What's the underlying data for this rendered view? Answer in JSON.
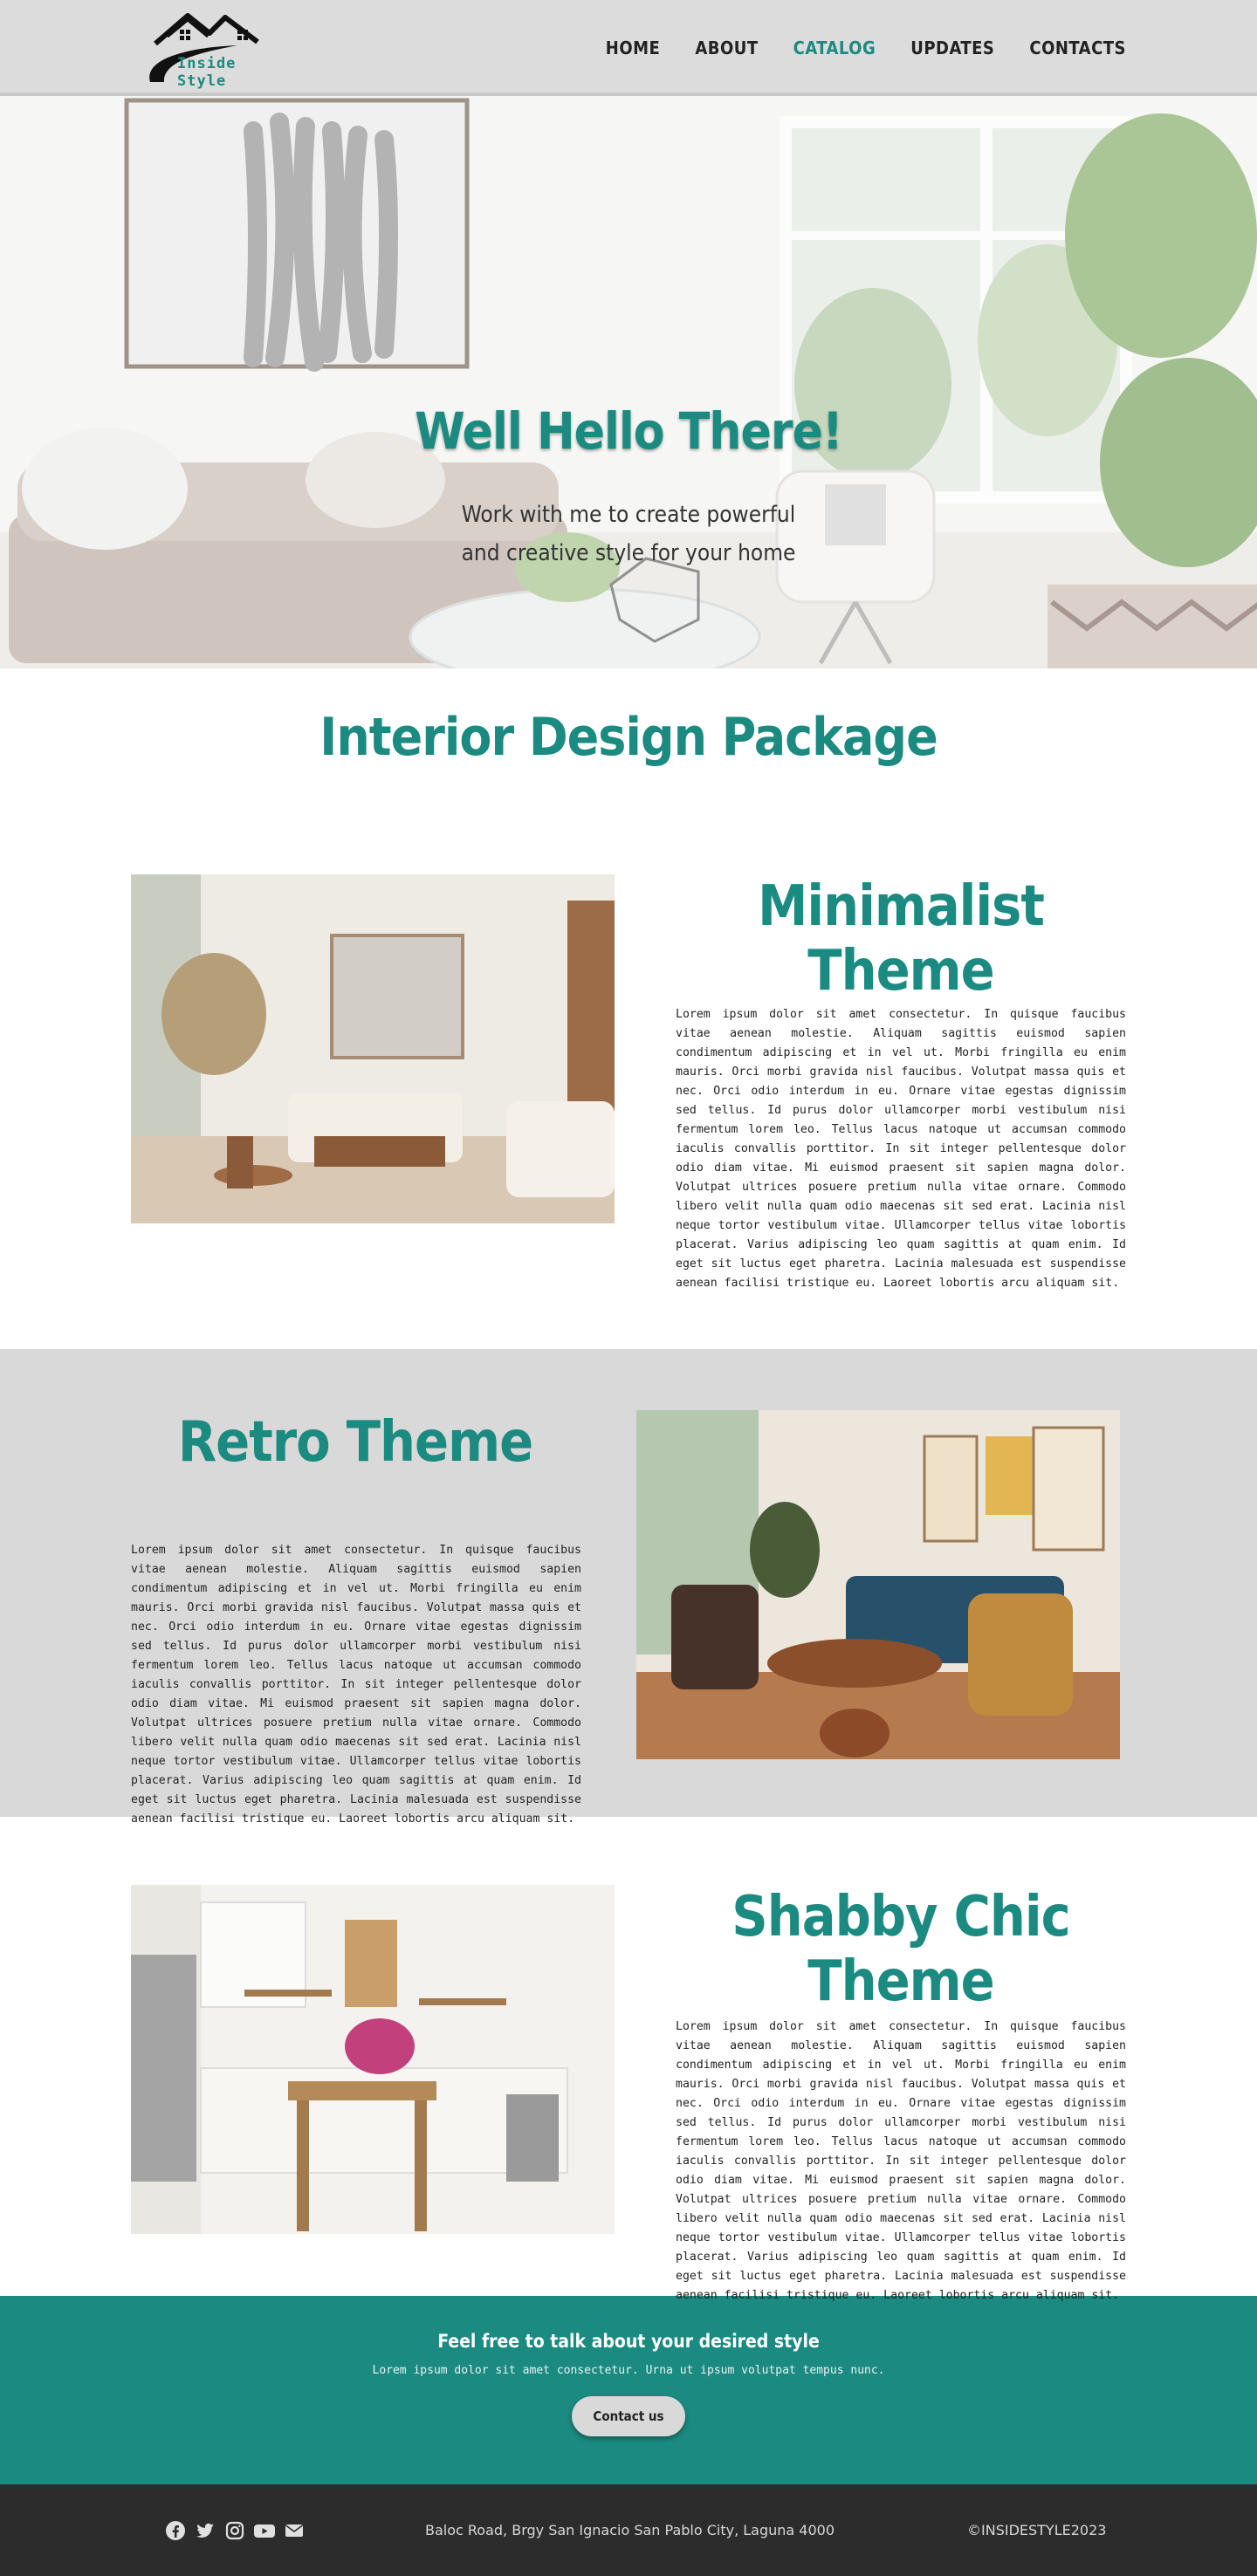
{
  "brand": {
    "name": "Inside Style",
    "accent": "#1b8a80"
  },
  "nav": {
    "items": [
      {
        "label": "HOME",
        "active": false
      },
      {
        "label": "ABOUT",
        "active": false
      },
      {
        "label": "CATALOG",
        "active": true
      },
      {
        "label": "UPDATES",
        "active": false
      },
      {
        "label": "CONTACTS",
        "active": false
      }
    ]
  },
  "hero": {
    "title": "Well Hello There!",
    "subtitle_line1": "Work with me to create powerful",
    "subtitle_line2": "and creative style for your home"
  },
  "package": {
    "title": "Interior Design Package"
  },
  "themes": [
    {
      "title": "Minimalist Theme",
      "body": "Lorem ipsum dolor sit amet consectetur. In quisque faucibus vitae aenean molestie. Aliquam sagittis euismod sapien condimentum adipiscing et in vel ut. Morbi fringilla eu enim mauris. Orci morbi gravida nisl faucibus. Volutpat massa quis et nec. Orci odio interdum in eu. Ornare vitae egestas dignissim sed tellus. Id purus dolor ullamcorper morbi vestibulum nisi fermentum lorem leo. Tellus lacus natoque ut accumsan commodo iaculis convallis porttitor. In sit integer pellentesque dolor odio diam vitae. Mi euismod praesent sit sapien magna dolor. Volutpat ultrices posuere pretium nulla vitae ornare. Commodo libero velit nulla quam odio maecenas sit sed erat. Lacinia nisl neque tortor vestibulum vitae. Ullamcorper tellus vitae lobortis placerat. Varius adipiscing leo quam sagittis at quam enim. Id eget sit luctus eget pharetra. Lacinia malesuada est suspendisse aenean facilisi tristique eu. Laoreet lobortis arcu aliquam sit."
    },
    {
      "title": "Retro Theme",
      "body": "Lorem ipsum dolor sit amet consectetur. In quisque faucibus vitae aenean molestie. Aliquam sagittis euismod sapien condimentum adipiscing et in vel ut. Morbi fringilla eu enim mauris. Orci morbi gravida nisl faucibus. Volutpat massa quis et nec. Orci odio interdum in eu. Ornare vitae egestas dignissim sed tellus. Id purus dolor ullamcorper morbi vestibulum nisi fermentum lorem leo. Tellus lacus natoque ut accumsan commodo iaculis convallis porttitor. In sit integer pellentesque dolor odio diam vitae. Mi euismod praesent sit sapien magna dolor. Volutpat ultrices posuere pretium nulla vitae ornare. Commodo libero velit nulla quam odio maecenas sit sed erat. Lacinia nisl neque tortor vestibulum vitae. Ullamcorper tellus vitae lobortis placerat. Varius adipiscing leo quam sagittis at quam enim. Id eget sit luctus eget pharetra. Lacinia malesuada est suspendisse aenean facilisi tristique eu. Laoreet lobortis arcu aliquam sit."
    },
    {
      "title": "Shabby Chic Theme",
      "body": "Lorem ipsum dolor sit amet consectetur. In quisque faucibus vitae aenean molestie. Aliquam sagittis euismod sapien condimentum adipiscing et in vel ut. Morbi fringilla eu enim mauris. Orci morbi gravida nisl faucibus. Volutpat massa quis et nec. Orci odio interdum in eu. Ornare vitae egestas dignissim sed tellus. Id purus dolor ullamcorper morbi vestibulum nisi fermentum lorem leo. Tellus lacus natoque ut accumsan commodo iaculis convallis porttitor. In sit integer pellentesque dolor odio diam vitae. Mi euismod praesent sit sapien magna dolor. Volutpat ultrices posuere pretium nulla vitae ornare. Commodo libero velit nulla quam odio maecenas sit sed erat. Lacinia nisl neque tortor vestibulum vitae. Ullamcorper tellus vitae lobortis placerat. Varius adipiscing leo quam sagittis at quam enim. Id eget sit luctus eget pharetra. Lacinia malesuada est suspendisse aenean facilisi tristique eu. Laoreet lobortis arcu aliquam sit."
    }
  ],
  "cta": {
    "title": "Feel free to talk about your desired style",
    "text": "Lorem ipsum dolor sit amet consectetur. Urna ut ipsum volutpat tempus nunc.",
    "button": "Contact us"
  },
  "footer": {
    "socials": [
      "facebook-icon",
      "twitter-icon",
      "instagram-icon",
      "youtube-icon",
      "mail-icon"
    ],
    "address": "Baloc Road, Brgy San Ignacio San Pablo City, Laguna 4000",
    "copyright": "©INSIDESTYLE2023"
  }
}
